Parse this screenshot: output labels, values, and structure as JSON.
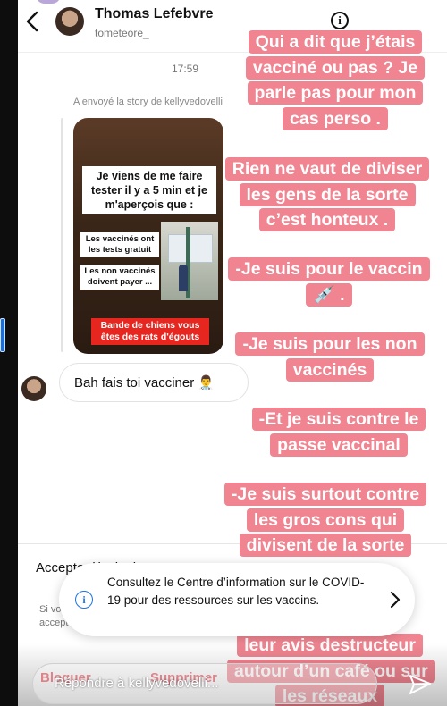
{
  "header": {
    "name": "Thomas Lefebvre",
    "handle": "tometeore_"
  },
  "conversation": {
    "time": "17:59",
    "story_note": "A envoyé la story de kellyvedovelli",
    "story": {
      "box1": "Je viens de me faire tester il y a 5 min et je m'aperçois que :",
      "box2": "Les vaccinés ont les tests gratuit",
      "box3": "Les non vaccinés doivent payer ...",
      "red": "Bande de chiens vous êtes des rats d'égouts"
    },
    "message": "Bah fais toi vacciner 👨‍⚕️"
  },
  "lower_panel": {
    "accept": "Accepter l'invitation",
    "si_text": "Si vous acceptez",
    "block_button": "Bloquer",
    "delete_button": "Supprimer"
  },
  "overlay": {
    "colors": {
      "highlight": "#f08591"
    },
    "blocks": [
      {
        "text": "Qui a dit que j’étais vacciné ou pas ? Je parle pas pour mon cas perso ."
      },
      {
        "text": "Rien ne vaut de diviser les gens de la sorte c’est honteux ."
      },
      {
        "text": "-Je suis pour le vaccin 💉 ."
      },
      {
        "text": "-Je suis pour les non vaccinés"
      },
      {
        "text": "-Et je suis contre le passe vaccinal"
      },
      {
        "text": "-Je suis surtout contre les gros cons qui divisent de la sorte"
      },
      {
        "text": "leur avis destructeur autour d’un café ou sur les réseaux"
      }
    ]
  },
  "toast": {
    "text": "Consultez le Centre d’information sur le COVID-19 pour des ressources sur les vaccins."
  },
  "reply": {
    "placeholder": "Répondre à kellyvedovelli..."
  }
}
